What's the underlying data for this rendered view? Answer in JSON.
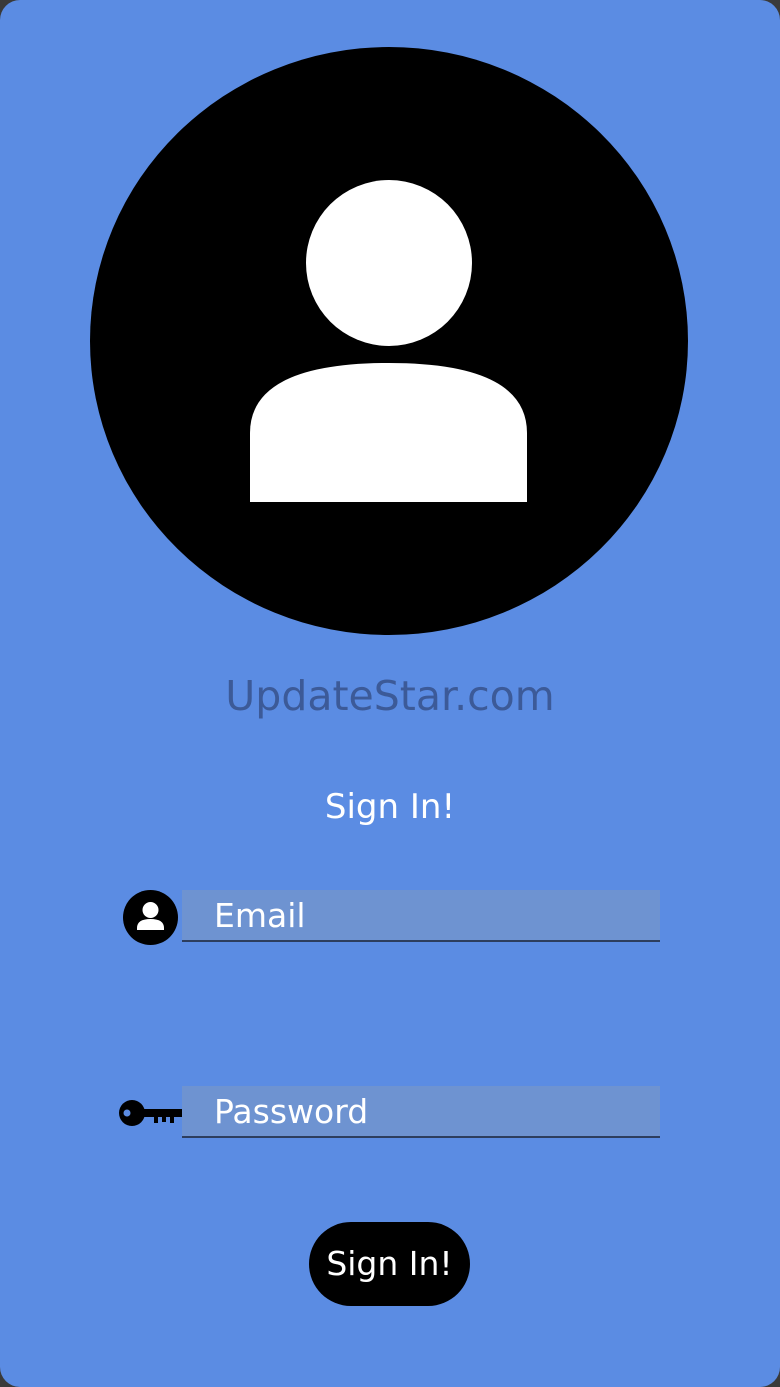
{
  "brand": {
    "name": "UpdateStar.com"
  },
  "form": {
    "heading": "Sign In!",
    "email": {
      "icon": "user-circle-icon",
      "placeholder": "Email",
      "value": ""
    },
    "password": {
      "icon": "key-icon",
      "placeholder": "Password",
      "value": ""
    },
    "submit_label": "Sign In!"
  },
  "avatar": {
    "icon": "user-avatar-icon"
  },
  "colors": {
    "background": "#5b8ce3",
    "brand_text": "#3c5a98",
    "input_fill": "#6e93d1",
    "button": "#000000"
  }
}
